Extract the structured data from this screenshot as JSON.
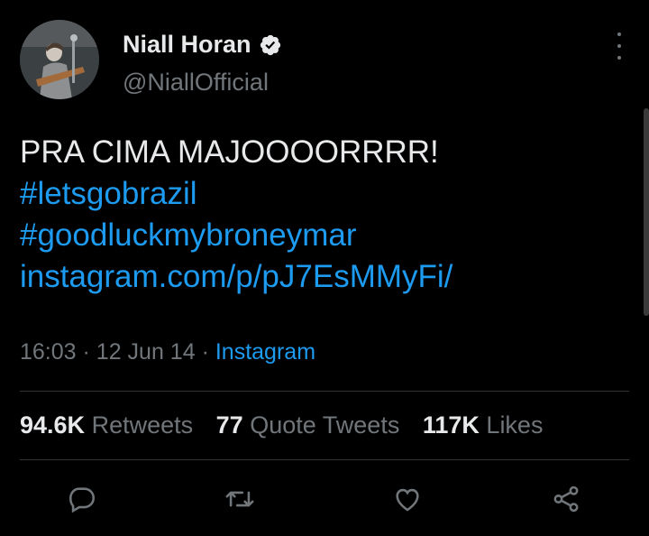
{
  "tweet": {
    "author": {
      "display_name": "Niall Horan",
      "handle": "@NiallOfficial",
      "verified": true
    },
    "text_lines": [
      {
        "text": "PRA CIMA MAJOOOORRRR!",
        "type": "plain"
      },
      {
        "text": "#letsgobrazil",
        "type": "hashtag"
      },
      {
        "text": "#goodluckmybroneymar",
        "type": "hashtag"
      },
      {
        "text": "instagram.com/p/pJ7EsMMyFi/",
        "type": "url"
      }
    ],
    "meta": {
      "time": "16:03",
      "separator": "·",
      "date": "12 Jun 14",
      "source": "Instagram"
    },
    "stats": {
      "retweets_count": "94.6K",
      "retweets_label": "Retweets",
      "quotes_count": "77",
      "quotes_label": "Quote Tweets",
      "likes_count": "117K",
      "likes_label": "Likes"
    },
    "actions": [
      {
        "name": "reply-icon"
      },
      {
        "name": "retweet-icon"
      },
      {
        "name": "like-icon"
      },
      {
        "name": "share-icon"
      }
    ]
  },
  "colors": {
    "background": "#000000",
    "text": "#e7e9ea",
    "secondary": "#71767b",
    "link": "#1d9bf0",
    "divider": "#2f3336",
    "verified_badge": "#e7e9ea"
  }
}
